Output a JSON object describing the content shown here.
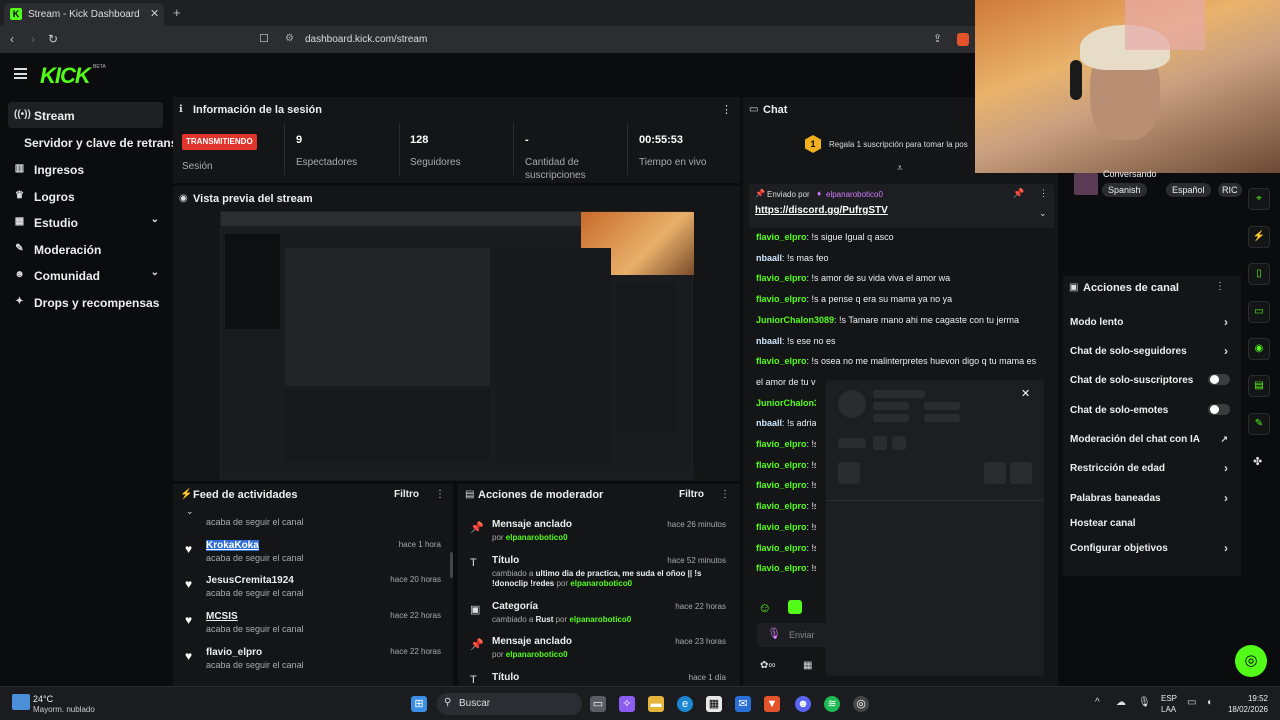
{
  "browser": {
    "tab_title": "Stream - Kick Dashboard",
    "favicon": "K",
    "url": "dashboard.kick.com/stream"
  },
  "brand": {
    "logo": "KICK",
    "beta": "BETA",
    "accent": "#53fc18"
  },
  "sidebar": {
    "items": [
      {
        "label": "Stream",
        "icon": "broadcast-icon"
      },
      {
        "label": "Servidor y clave de retransmisión",
        "icon": ""
      },
      {
        "label": "Ingresos",
        "icon": "chart-icon"
      },
      {
        "label": "Logros",
        "icon": "trophy-icon"
      },
      {
        "label": "Estudio",
        "icon": "grid-icon",
        "expandable": true
      },
      {
        "label": "Moderación",
        "icon": "wrench-icon"
      },
      {
        "label": "Comunidad",
        "icon": "people-icon",
        "expandable": true
      },
      {
        "label": "Drops y recompensas",
        "icon": "gift-icon"
      }
    ]
  },
  "session": {
    "title": "Información de la sesión",
    "status": "TRANSMITIENDO",
    "status_label": "Sesión",
    "stats": [
      {
        "value": "9",
        "label": "Espectadores"
      },
      {
        "value": "128",
        "label": "Seguidores"
      },
      {
        "value": "-",
        "label": "Cantidad de suscripciones"
      },
      {
        "value": "00:55:53",
        "label": "Tiempo en vivo"
      }
    ]
  },
  "preview": {
    "title": "Vista previa del stream"
  },
  "feed": {
    "title": "Feed de actividades",
    "filter": "Filtro",
    "items": [
      {
        "name": "",
        "sub": "acaba de seguir el canal",
        "time": ""
      },
      {
        "name": "KrokaKoka",
        "sub": "acaba de seguir el canal",
        "time": "hace 1 hora"
      },
      {
        "name": "JesusCremita1924",
        "sub": "acaba de seguir el canal",
        "time": "hace 20 horas"
      },
      {
        "name": "MCSIS",
        "sub": "acaba de seguir el canal",
        "time": "hace 22 horas"
      },
      {
        "name": "flavio_elpro",
        "sub": "acaba de seguir el canal",
        "time": "hace 22 horas"
      }
    ]
  },
  "modactions": {
    "title": "Acciones de moderador",
    "filter": "Filtro",
    "items": [
      {
        "title": "Mensaje anclado",
        "time": "hace 26 minutos",
        "by": "por",
        "user": "elpanarobotico0"
      },
      {
        "title": "Título",
        "time": "hace 52 minutos",
        "changed": "cambiado a",
        "value": "ultimo dia de practica, me suda el oñoo || !s !donoclip !redes",
        "by": "por",
        "user": "elpanarobotico0"
      },
      {
        "title": "Categoría",
        "time": "hace 22 horas",
        "changed": "cambiado a",
        "value": "Rust",
        "by": "por",
        "user": "elpanarobotico0"
      },
      {
        "title": "Mensaje anclado",
        "time": "hace 23 horas",
        "by": "por",
        "user": "elpanarobotico0"
      },
      {
        "title": "Título",
        "time": "hace 1 día"
      }
    ]
  },
  "chat": {
    "title": "Chat",
    "promo": "Regala 1 suscripción para tomar la pos",
    "pinned_by_label": "Enviado por",
    "pinned_by": "elpanarobotico0",
    "pinned_link": "https://discord.gg/PufrgSTV",
    "input_placeholder": "Enviar",
    "messages": [
      {
        "user": "flavio_elpro",
        "text": "!s sigue Igual q asco",
        "color": "#53fc18"
      },
      {
        "user": "nbaall",
        "text": "!s mas feo",
        "color": "#53fc18"
      },
      {
        "user": "flavio_elpro",
        "text": "!s amor de su vida viva el amor wa",
        "color": "#53fc18"
      },
      {
        "user": "flavio_elpro",
        "text": "!s a pense q era su mama ya no ya",
        "color": "#53fc18"
      },
      {
        "user": "JuniorChalon3089",
        "text": "!s Tamare mano ahi me cagaste con tu jerma",
        "color": "#53fc18"
      },
      {
        "user": "nbaall",
        "text": "!s ese no es",
        "color": "#53fc18"
      },
      {
        "user": "flavio_elpro",
        "text": "!s osea no me malinterpretes huevon digo q tu mama es",
        "color": "#53fc18"
      },
      {
        "user": "",
        "text": "el amor de tu v",
        "color": "#53fc18"
      },
      {
        "user": "JuniorChalon3",
        "text": "",
        "color": "#53fc18"
      },
      {
        "user": "nbaall",
        "text": "!s adria",
        "color": "#53fc18"
      },
      {
        "user": "flavio_elpro",
        "text": "!s",
        "color": "#53fc18"
      },
      {
        "user": "flavio_elpro",
        "text": "!s",
        "color": "#53fc18"
      },
      {
        "user": "flavio_elpro",
        "text": "!s",
        "color": "#53fc18"
      },
      {
        "user": "flavio_elpro",
        "text": "!s",
        "color": "#53fc18"
      },
      {
        "user": "flavio_elpro",
        "text": "!s",
        "color": "#53fc18"
      },
      {
        "user": "flavio_elpro",
        "text": "!s",
        "color": "#53fc18"
      },
      {
        "user": "flavio_elpro",
        "text": "!s",
        "color": "#53fc18"
      }
    ]
  },
  "profile": {
    "status": "Conversando",
    "tags": [
      "Spanish",
      "Español",
      "RIC"
    ]
  },
  "channel_actions": {
    "title": "Acciones de canal",
    "items": [
      {
        "label": "Modo lento",
        "control": "arrow"
      },
      {
        "label": "Chat de solo-seguidores",
        "control": "arrow"
      },
      {
        "label": "Chat de solo-suscriptores",
        "control": "toggle"
      },
      {
        "label": "Chat de solo-emotes",
        "control": "toggle"
      },
      {
        "label": "Moderación del chat con IA",
        "control": "external"
      },
      {
        "label": "Restricción de edad",
        "control": "arrow"
      },
      {
        "label": "Palabras baneadas",
        "control": "arrow"
      },
      {
        "label": "Hostear canal",
        "control": "none"
      },
      {
        "label": "Configurar objetivos",
        "control": "arrow"
      }
    ]
  },
  "taskbar": {
    "weather_temp": "24°C",
    "weather_desc": "Mayorm. nublado",
    "search": "Buscar",
    "lang": "ESP",
    "lang2": "LAA",
    "time": "19:52",
    "date": "18/02/2026"
  }
}
